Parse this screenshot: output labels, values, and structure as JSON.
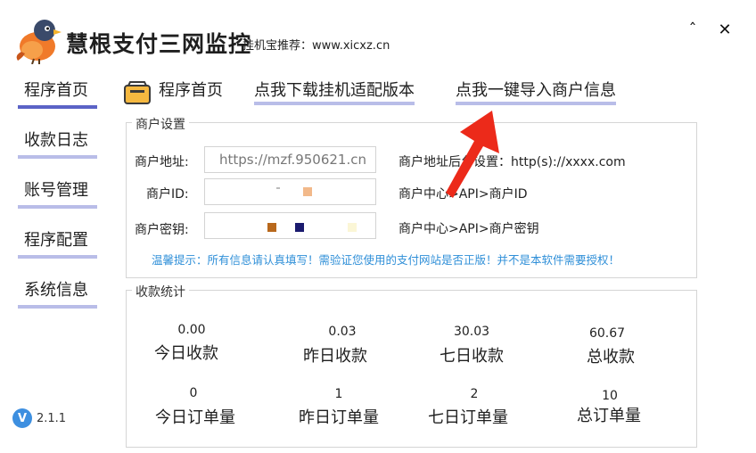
{
  "app": {
    "title": "慧根支付三网监控",
    "subtitle": "挂机宝推荐：www.xicxz.cn",
    "window": {
      "minimize_glyph": "ˆ",
      "close_glyph": "✕"
    },
    "version": {
      "badge": "V",
      "text": "2.1.1"
    },
    "accent_color": "#5b63c6",
    "tab_underline_color": "#b9bde8"
  },
  "sidebar": {
    "items": [
      {
        "label": "程序首页",
        "active": true
      },
      {
        "label": "收款日志",
        "active": false
      },
      {
        "label": "账号管理",
        "active": false
      },
      {
        "label": "程序配置",
        "active": false
      },
      {
        "label": "系统信息",
        "active": false
      }
    ]
  },
  "top_tabs": {
    "home_icon": "wallet-icon",
    "home": "程序首页",
    "download": "点我下载挂机适配版本",
    "import": "点我一键导入商户信息"
  },
  "merchant": {
    "group_title": "商户设置",
    "address_label": "商户地址:",
    "address_value": "https://mzf.950621.cn",
    "address_hint": "商户地址后台设置：http(s)://xxxx.com",
    "id_label": "商户ID:",
    "id_hint": "商户中心>API>商户ID",
    "key_label": "商户密钥:",
    "key_hint": "商户中心>API>商户密钥",
    "tip": "温馨提示：所有信息请认真填写！需验证您使用的支付网站是否正版！并不是本软件需要授权！"
  },
  "stats": {
    "group_title": "收款统计",
    "today_amount": {
      "value": "0.00",
      "label": "今日收款"
    },
    "yesterday_amount": {
      "value": "0.03",
      "label": "昨日收款"
    },
    "week_amount": {
      "value": "30.03",
      "label": "七日收款"
    },
    "total_amount": {
      "value": "60.67",
      "label": "总收款"
    },
    "today_orders": {
      "value": "0",
      "label": "今日订单量"
    },
    "yesterday_orders": {
      "value": "1",
      "label": "昨日订单量"
    },
    "week_orders": {
      "value": "2",
      "label": "七日订单量"
    },
    "total_orders": {
      "value": "10",
      "label": "总订单量"
    }
  }
}
